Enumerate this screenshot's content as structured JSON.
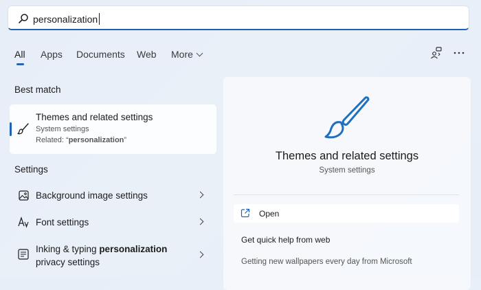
{
  "search": {
    "value": "personalization"
  },
  "tabs": [
    "All",
    "Apps",
    "Documents",
    "Web",
    "More"
  ],
  "best_match": {
    "heading": "Best match",
    "title": "Themes and related settings",
    "subtitle": "System settings",
    "related_prefix": "Related: “",
    "related_term": "personalization",
    "related_suffix": "”"
  },
  "settings": {
    "heading": "Settings",
    "items": [
      {
        "label": "Background image settings",
        "icon": "image-icon"
      },
      {
        "label": "Font settings",
        "icon": "font-icon"
      },
      {
        "label_prefix": "Inking & typing ",
        "label_bold": "personalization",
        "label_line2": "privacy settings",
        "icon": "inking-typing-icon"
      }
    ]
  },
  "detail": {
    "title": "Themes and related settings",
    "subtitle": "System settings",
    "open_label": "Open",
    "help_heading": "Get quick help from web",
    "help_link": "Getting new wallpapers every day from Microsoft"
  },
  "colors": {
    "accent": "#1f62b5",
    "brush_icon": "#1f6fbf"
  }
}
